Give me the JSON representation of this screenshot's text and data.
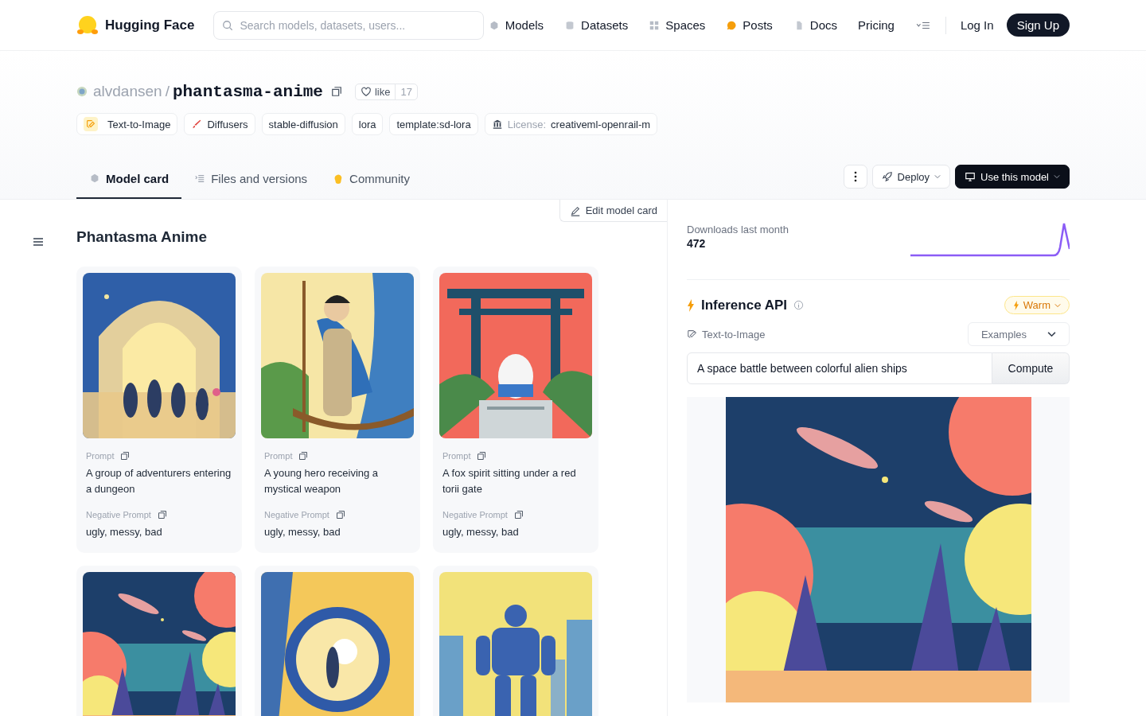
{
  "nav": {
    "brand": "Hugging Face",
    "search": {
      "placeholder": "Search models, datasets, users..."
    },
    "links": [
      {
        "label": "Models"
      },
      {
        "label": "Datasets"
      },
      {
        "label": "Spaces"
      },
      {
        "label": "Posts"
      },
      {
        "label": "Docs"
      },
      {
        "label": "Pricing"
      }
    ],
    "login": "Log In",
    "signup": "Sign Up"
  },
  "repo": {
    "owner": "alvdansen",
    "separator": "/",
    "name": "phantasma-anime",
    "like": "like",
    "likes": "17",
    "tags": [
      {
        "label": "Text-to-Image"
      },
      {
        "label": "Diffusers"
      },
      {
        "label": "stable-diffusion"
      },
      {
        "label": "lora"
      },
      {
        "label": "template:sd-lora"
      },
      {
        "prefix": "License:",
        "label": "creativeml-openrail-m"
      }
    ]
  },
  "tabs": [
    {
      "label": "Model card",
      "selected": true
    },
    {
      "label": "Files and versions",
      "selected": false
    },
    {
      "label": "Community",
      "selected": false
    }
  ],
  "actions": {
    "deploy": "Deploy",
    "use": "Use this model"
  },
  "card": {
    "edit": "Edit model card",
    "title": "Phantasma Anime",
    "examples": [
      {
        "kind": "example",
        "prompt_label": "Prompt",
        "prompt": "A group of adventurers entering a dungeon",
        "negative_label": "Negative Prompt",
        "negative": "ugly, messy, bad"
      },
      {
        "kind": "example",
        "prompt_label": "Prompt",
        "prompt": "A young hero receiving a mystical weapon",
        "negative_label": "Negative Prompt",
        "negative": "ugly, messy, bad"
      },
      {
        "kind": "example",
        "prompt_label": "Prompt",
        "prompt": "A fox spirit sitting under a red torii gate",
        "negative_label": "Negative Prompt",
        "negative": "ugly, messy, bad"
      },
      {
        "kind": "picture"
      },
      {
        "kind": "picture"
      },
      {
        "kind": "picture"
      }
    ]
  },
  "sidebar": {
    "downloads_label": "Downloads last month",
    "downloads": "472",
    "inference": {
      "title": "Inference API",
      "status": "Warm",
      "task": "Text-to-Image",
      "examples": "Examples",
      "input_value": "A space battle between colorful alien ships",
      "compute": "Compute"
    }
  }
}
